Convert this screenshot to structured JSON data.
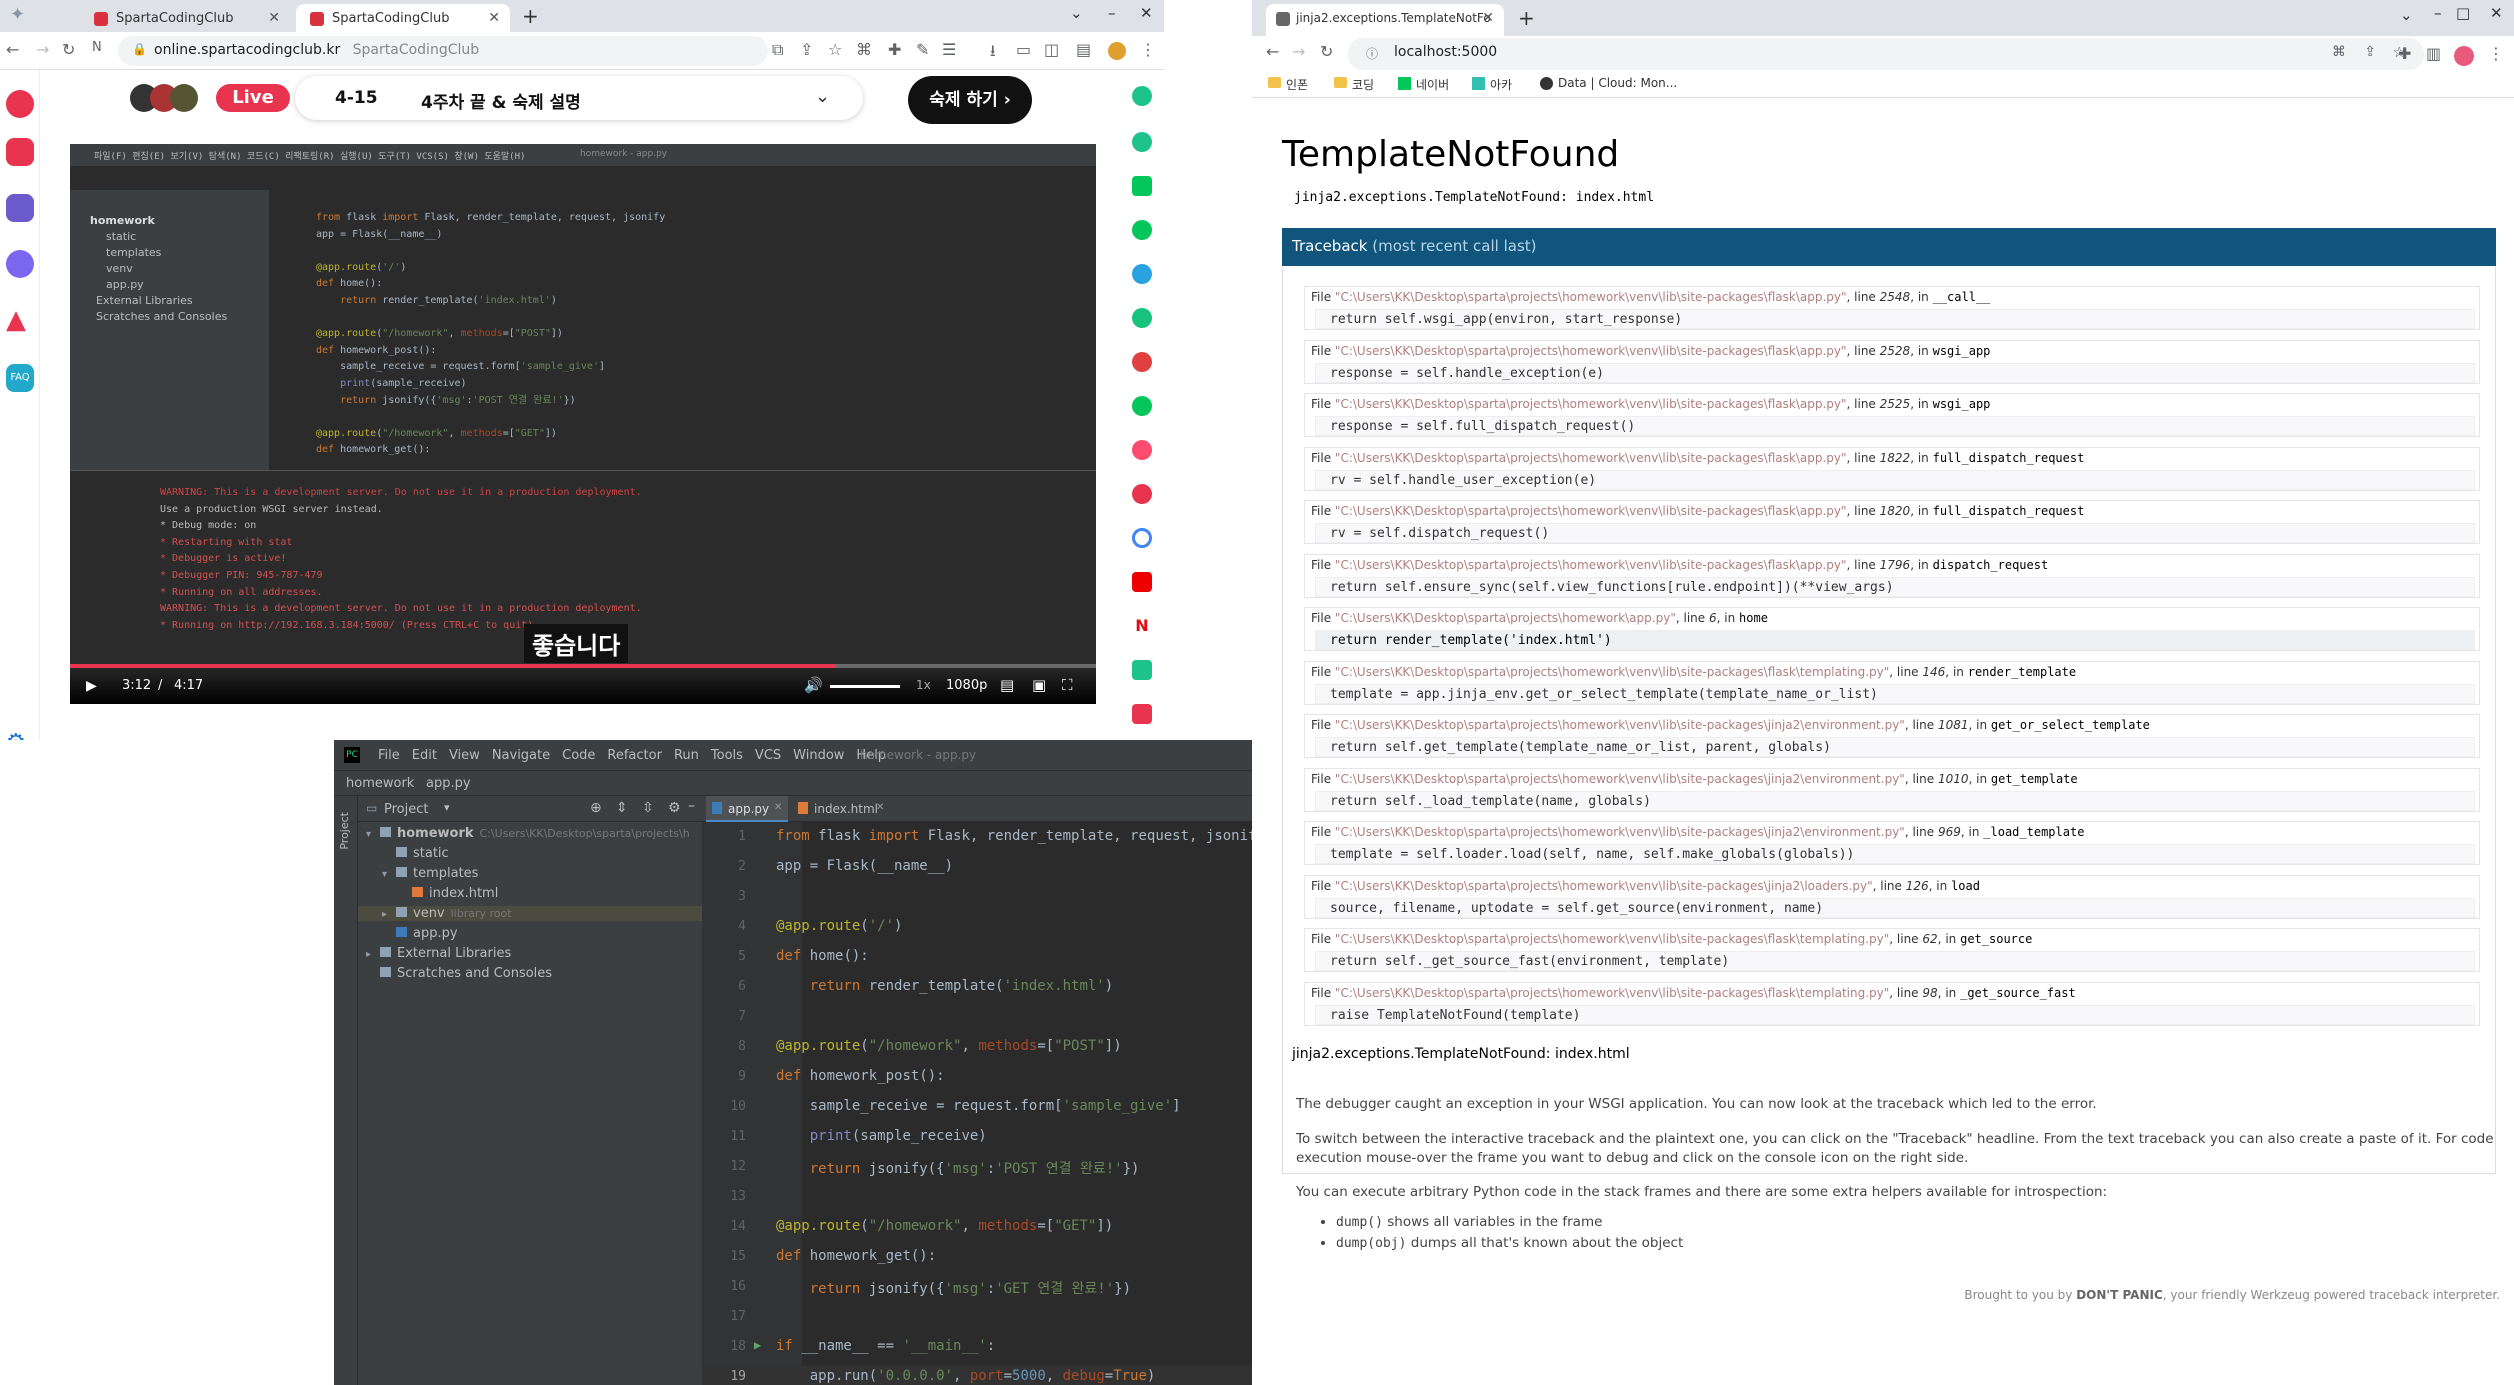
{
  "left_browser": {
    "tabs": [
      {
        "title": "SpartaCodingClub",
        "active": false
      },
      {
        "title": "SpartaCodingClub",
        "active": true
      }
    ],
    "url": "online.spartacodingclub.kr",
    "url_suffix": "SpartaCodingClub",
    "live_badge": "Live",
    "lecture_code": "4-15",
    "lecture_title": "4주차 끝 & 숙제 설명",
    "homework_button": "숙제 하기 ›",
    "sidebar_icons": [
      "sparta-logo-icon",
      "code-icon",
      "checklist-icon",
      "chat-icon",
      "alert-icon",
      "faq-icon"
    ],
    "sidebar_faq": "FAQ",
    "settings_icon": "gear-icon"
  },
  "video": {
    "subtitle": "좋습니다",
    "time_current": "3:12",
    "time_sep": "/",
    "time_total": "4:17",
    "speed": "1x",
    "quality": "1080p",
    "progress": 0.747,
    "ide_menu": "파일(F)  편집(E)  보기(V)  탐색(N)  코드(C)  리팩토링(R)  실행(U)  도구(T)  VCS(S)  창(W)  도움말(H)",
    "ide_title": "homework - app.py",
    "console_lines": [
      {
        "text": "WARNING: This is a development server. Do not use it in a production deployment.",
        "color": "#cc4444"
      },
      {
        "text": "Use a production WSGI server instead.",
        "color": "#bbbbbb"
      },
      {
        "text": "* Debug mode: on",
        "color": "#bbbbbb"
      },
      {
        "text": "* Restarting with stat",
        "color": "#d45050"
      },
      {
        "text": "* Debugger is active!",
        "color": "#d45050"
      },
      {
        "text": "* Debugger PIN: 945-787-479",
        "color": "#d45050"
      },
      {
        "text": "* Running on all addresses.",
        "color": "#d45050"
      },
      {
        "text": "WARNING: This is a development server. Do not use it in a production deployment.",
        "color": "#d45050"
      },
      {
        "text": "* Running on http://192.168.3.184:5000/ (Press CTRL+C to quit)",
        "color": "#d45050"
      }
    ]
  },
  "ide": {
    "menu": [
      "File",
      "Edit",
      "View",
      "Navigate",
      "Code",
      "Refactor",
      "Run",
      "Tools",
      "VCS",
      "Window",
      "Help"
    ],
    "title": "homework - app.py",
    "breadcrumb": [
      "homework",
      "app.py"
    ],
    "project_label": "Project",
    "side_tab": "Project",
    "tabs": [
      {
        "label": "app.py",
        "active": true
      },
      {
        "label": "index.html",
        "active": false
      }
    ],
    "tree": [
      {
        "label": "homework",
        "extra": "C:\\Users\\KK\\Desktop\\sparta\\projects\\h",
        "indent": 0,
        "type": "folder",
        "arrow": "v"
      },
      {
        "label": "static",
        "extra": "",
        "indent": 1,
        "type": "folder",
        "arrow": ""
      },
      {
        "label": "templates",
        "extra": "",
        "indent": 1,
        "type": "folder",
        "arrow": "v"
      },
      {
        "label": "index.html",
        "extra": "",
        "indent": 2,
        "type": "html",
        "arrow": ""
      },
      {
        "label": "venv",
        "extra": "library root",
        "indent": 1,
        "type": "folder",
        "arrow": ">"
      },
      {
        "label": "app.py",
        "extra": "",
        "indent": 1,
        "type": "py",
        "arrow": ""
      },
      {
        "label": "External Libraries",
        "extra": "",
        "indent": 0,
        "type": "lib",
        "arrow": ">"
      },
      {
        "label": "Scratches and Consoles",
        "extra": "",
        "indent": 0,
        "type": "scratch",
        "arrow": ""
      }
    ],
    "code_lines": [
      "from flask import Flask, render_template, request, jsonify",
      "app = Flask(__name__)",
      "",
      "@app.route('/')",
      "def home():",
      "    return render_template('index.html')",
      "",
      "@app.route(\"/homework\", methods=[\"POST\"])",
      "def homework_post():",
      "    sample_receive = request.form['sample_give']",
      "    print(sample_receive)",
      "    return jsonify({'msg':'POST 연결 완료!'})",
      "",
      "@app.route(\"/homework\", methods=[\"GET\"])",
      "def homework_get():",
      "    return jsonify({'msg':'GET 연결 완료!'})",
      "",
      "if __name__ == '__main__':",
      "    app.run('0.0.0.0', port=5000, debug=True)"
    ]
  },
  "right_browser": {
    "tab_title": "jinja2.exceptions.TemplateNotFo",
    "url": "localhost:5000",
    "bookmarks": [
      "인폰",
      "코딩",
      "네이버",
      "아카",
      "Data | Cloud: Mon..."
    ]
  },
  "error_page": {
    "title": "TemplateNotFound",
    "subtitle": "jinja2.exceptions.TemplateNotFound: index.html",
    "traceback_label": "Traceback",
    "traceback_note": "(most recent call last)",
    "frames": [
      {
        "path": "C:\\Users\\KK\\Desktop\\sparta\\projects\\homework\\venv\\lib\\site-packages\\flask\\app.py",
        "line": "2548",
        "func": "__call__",
        "code": "return self.wsgi_app(environ, start_response)"
      },
      {
        "path": "C:\\Users\\KK\\Desktop\\sparta\\projects\\homework\\venv\\lib\\site-packages\\flask\\app.py",
        "line": "2528",
        "func": "wsgi_app",
        "code": "response = self.handle_exception(e)"
      },
      {
        "path": "C:\\Users\\KK\\Desktop\\sparta\\projects\\homework\\venv\\lib\\site-packages\\flask\\app.py",
        "line": "2525",
        "func": "wsgi_app",
        "code": "response = self.full_dispatch_request()"
      },
      {
        "path": "C:\\Users\\KK\\Desktop\\sparta\\projects\\homework\\venv\\lib\\site-packages\\flask\\app.py",
        "line": "1822",
        "func": "full_dispatch_request",
        "code": "rv = self.handle_user_exception(e)"
      },
      {
        "path": "C:\\Users\\KK\\Desktop\\sparta\\projects\\homework\\venv\\lib\\site-packages\\flask\\app.py",
        "line": "1820",
        "func": "full_dispatch_request",
        "code": "rv = self.dispatch_request()"
      },
      {
        "path": "C:\\Users\\KK\\Desktop\\sparta\\projects\\homework\\venv\\lib\\site-packages\\flask\\app.py",
        "line": "1796",
        "func": "dispatch_request",
        "code": "return self.ensure_sync(self.view_functions[rule.endpoint])(**view_args)"
      },
      {
        "path": "C:\\Users\\KK\\Desktop\\sparta\\projects\\homework\\app.py",
        "line": "6",
        "func": "home",
        "code": "return render_template('index.html')",
        "highlight": true
      },
      {
        "path": "C:\\Users\\KK\\Desktop\\sparta\\projects\\homework\\venv\\lib\\site-packages\\flask\\templating.py",
        "line": "146",
        "func": "render_template",
        "code": "template = app.jinja_env.get_or_select_template(template_name_or_list)"
      },
      {
        "path": "C:\\Users\\KK\\Desktop\\sparta\\projects\\homework\\venv\\lib\\site-packages\\jinja2\\environment.py",
        "line": "1081",
        "func": "get_or_select_template",
        "code": "return self.get_template(template_name_or_list, parent, globals)"
      },
      {
        "path": "C:\\Users\\KK\\Desktop\\sparta\\projects\\homework\\venv\\lib\\site-packages\\jinja2\\environment.py",
        "line": "1010",
        "func": "get_template",
        "code": "return self._load_template(name, globals)"
      },
      {
        "path": "C:\\Users\\KK\\Desktop\\sparta\\projects\\homework\\venv\\lib\\site-packages\\jinja2\\environment.py",
        "line": "969",
        "func": "_load_template",
        "code": "template = self.loader.load(self, name, self.make_globals(globals))"
      },
      {
        "path": "C:\\Users\\KK\\Desktop\\sparta\\projects\\homework\\venv\\lib\\site-packages\\jinja2\\loaders.py",
        "line": "126",
        "func": "load",
        "code": "source, filename, uptodate = self.get_source(environment, name)"
      },
      {
        "path": "C:\\Users\\KK\\Desktop\\sparta\\projects\\homework\\venv\\lib\\site-packages\\flask\\templating.py",
        "line": "62",
        "func": "get_source",
        "code": "return self._get_source_fast(environment, template)"
      },
      {
        "path": "C:\\Users\\KK\\Desktop\\sparta\\projects\\homework\\venv\\lib\\site-packages\\flask\\templating.py",
        "line": "98",
        "func": "_get_source_fast",
        "code": "raise TemplateNotFound(template)"
      }
    ],
    "file_prefix": "File",
    "line_prefix": "line",
    "in_prefix": "in",
    "error_line": "jinja2.exceptions.TemplateNotFound: index.html",
    "explain1": "The debugger caught an exception in your WSGI application. You can now look at the traceback which led to the error.",
    "explain2": "To switch between the interactive traceback and the plaintext one, you can click on the \"Traceback\" headline. From the text traceback you can also create a paste of it. For code execution mouse-over the frame you want to debug and click on the console icon on the right side.",
    "explain3": "You can execute arbitrary Python code in the stack frames and there are some extra helpers available for introspection:",
    "helpers": [
      {
        "code": "dump()",
        "text": " shows all variables in the frame"
      },
      {
        "code": "dump(obj)",
        "text": " dumps all that's known about the object"
      }
    ],
    "footer_pre": "Brought to you by ",
    "footer_brand": "DON'T PANIC",
    "footer_post": ", your friendly Werkzeug powered traceback interpreter."
  },
  "colors": {
    "traceback_bar": "#11557c",
    "live_red": "#e8344e",
    "ide_bg": "#2b2b2b",
    "ide_panel": "#3c3f41"
  }
}
